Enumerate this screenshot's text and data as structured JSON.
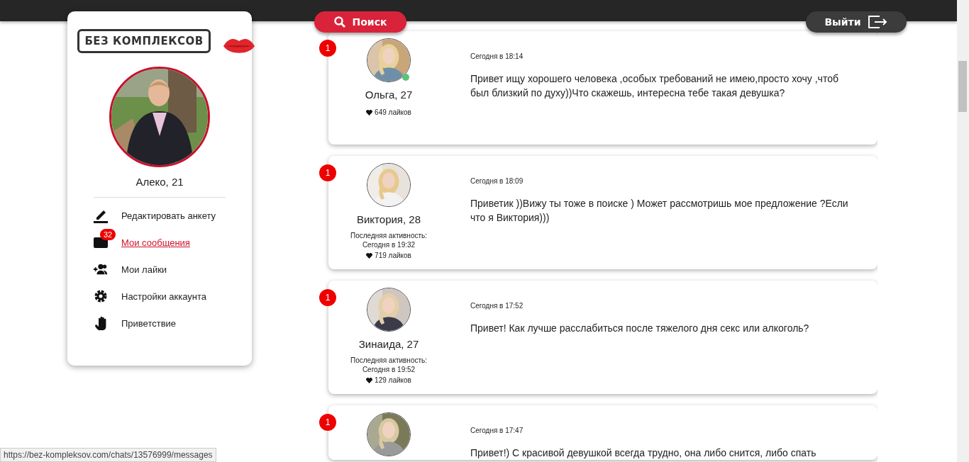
{
  "logo": {
    "text": "БЕЗ КОМПЛЕКСОВ"
  },
  "search_button": {
    "label": "Поиск"
  },
  "logout_button": {
    "label": "Выйти"
  },
  "profile": {
    "name": "Алеко, 21"
  },
  "menu": [
    {
      "kind": "edit",
      "label": "Редактировать анкету",
      "selected": false
    },
    {
      "kind": "messages",
      "label": "Мои сообщения",
      "selected": true,
      "badge": "32"
    },
    {
      "kind": "likes",
      "label": "Мои лайки",
      "selected": false
    },
    {
      "kind": "settings",
      "label": "Настройки аккаунта",
      "selected": false
    },
    {
      "kind": "greeting",
      "label": "Приветствие",
      "selected": false
    }
  ],
  "chats": [
    {
      "unread": "1",
      "online": true,
      "name": "Ольга, 27",
      "likes": "649 лайков",
      "time": "Сегодня в 18:14",
      "message": "Привет ищу хорошего человека ,особых требований не имею,просто хочу ,чтоб был близкий по духу))Что скажешь, интересна тебе такая девушка?"
    },
    {
      "unread": "1",
      "online": false,
      "name": "Виктория, 28",
      "last_active_label": "Последняя активность:",
      "last_active": "Сегодня в 19:32",
      "likes": "719 лайков",
      "time": "Сегодня в 18:09",
      "message": "Приветик ))Вижу ты тоже в поиске ) Может рассмотришь мое предложение ?Если что я Виктория)))"
    },
    {
      "unread": "1",
      "online": false,
      "name": "Зинаида, 27",
      "last_active_label": "Последняя активность:",
      "last_active": "Сегодня в 19:52",
      "likes": "129 лайков",
      "time": "Сегодня в 17:52",
      "message": "Привет! Как лучше расслабиться после тяжелого дня секс или алкоголь?"
    },
    {
      "unread": "1",
      "online": false,
      "time": "Сегодня в 17:47",
      "message": "Привет!) С красивой девушкой всегда трудно, она либо снится, либо спать"
    }
  ],
  "status_bar": {
    "url": "https://bez-kompleksov.com/chats/13576999/messages"
  }
}
